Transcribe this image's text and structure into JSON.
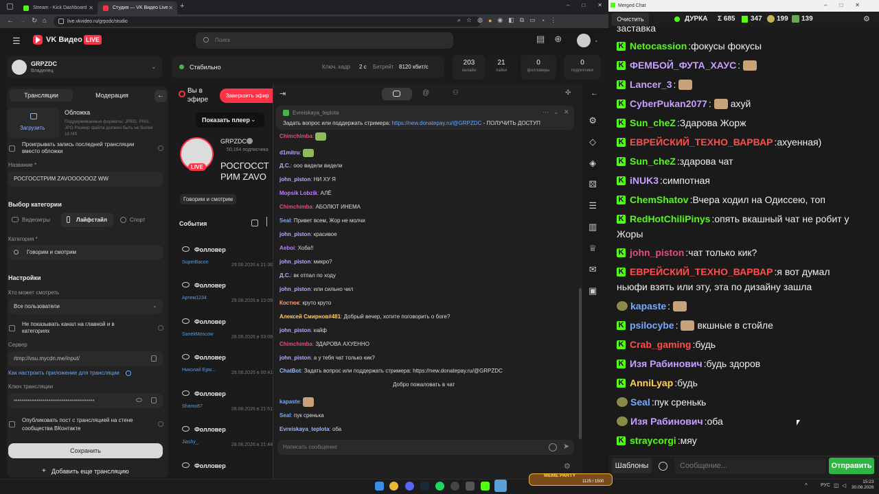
{
  "browser": {
    "tabs": [
      {
        "label": "Stream - Kick Dashboard",
        "favicon_color": "#53fc18"
      },
      {
        "label": "Студия — VK Видео Live",
        "favicon_color": "#ff3347"
      }
    ],
    "new_tab": "+",
    "url": "live.vkvideo.ru/grpzdc/studio",
    "win_controls": [
      "–",
      "□",
      "✕"
    ]
  },
  "vk": {
    "logo_text": "VK Видео",
    "live_badge": "LIVE",
    "search_placeholder": "Поиск",
    "channel": {
      "name": "GRPZDC",
      "role": "Владелец"
    },
    "status": "Стабильно",
    "keyframe_label": "Ключ. кадр",
    "keyframe_value": "2 с",
    "bitrate_label": "Битрейт",
    "bitrate_value": "8120 кбит/с",
    "stats": [
      {
        "value": "203",
        "label": "онлайн"
      },
      {
        "value": "21",
        "label": "лайки"
      },
      {
        "value": "0",
        "label": "фолловеры"
      },
      {
        "value": "0",
        "label": "подписчики"
      }
    ],
    "left_tabs": [
      "Трансляции",
      "Модерация"
    ],
    "cover": {
      "upload_label": "Загрузить",
      "title": "Обложка",
      "desc": "Поддерживаемые форматы: JPEG, PNG, JPG Размер файла должен быть не более 10 Мб"
    },
    "play_last": "Проигрывать запись последней трансляции вместо обложки",
    "name_label": "Название *",
    "name_value": "РОСГОССТРИМ ZAVOOOOOOZ WW",
    "category_section": "Выбор категории",
    "category_tabs": [
      "Видеоигры",
      "Лайфстайл",
      "Спорт"
    ],
    "category_label": "Категория *",
    "category_value": "Говорим и смотрим",
    "settings": "Настройки",
    "who_label": "Кто может смотреть",
    "who_value": "Все пользователи",
    "hide_label": "Не показывать канал на главной и в категориях",
    "server_label": "Сервер",
    "server_value": "rtmp://vsu.mycdn.me/input/",
    "howto": "Как настроить приложение для трансляции",
    "key_label": "Ключ трансляции",
    "key_value": "••••••••••••••••••••••••••••••••••••••••••",
    "publish_label": "Опубликовать пост с трансляцией на стене сообщества ВКонтакте",
    "save": "Сохранить",
    "add_stream": "Добавить еще трансляцию",
    "on_air": "Вы в эфире",
    "end_btn": "Завершить эфир",
    "show_player": "Показать плеер",
    "stream_channel": "GRPZDC",
    "stream_subs": "50,164 подписчика",
    "stream_title": "РОСГОССТРИМ ZAVOOOOOOZ WW",
    "stream_tag": "Говорим и смотрим",
    "events_title": "События",
    "events": [
      {
        "type": "Фолловер",
        "name": "SuperBacon",
        "date": "29.08.2026 в 21:36"
      },
      {
        "type": "Фолловер",
        "name": "Артем1234",
        "date": "29.08.2026 в 10:09"
      },
      {
        "type": "Фолловер",
        "name": "SanekMoscow",
        "date": "28.08.2026 в 03:09"
      },
      {
        "type": "Фолловер",
        "name": "Николай Ерм...",
        "date": "28.08.2026 в 00:41"
      },
      {
        "type": "Фолловер",
        "name": "Shamo87",
        "date": "28.08.2026 в 21:51"
      },
      {
        "type": "Фолловер",
        "name": "Jiashy_",
        "date": "28.08.2026 в 21:44"
      },
      {
        "type": "Фолловер",
        "name": "",
        "date": ""
      }
    ],
    "chat": {
      "pinned_user": "Evreiskaya_teplota",
      "pinned_text": "Задать вопрос или поддержать стримера: ",
      "pinned_link": "https://new.donatepay.ru/@GRPZDC",
      "pinned_tail": " - ПОЛУЧИТЬ ДОСТУП",
      "messages": [
        {
          "user": "Chimchimba",
          "text": "",
          "color": "#e0507a"
        },
        {
          "user": "d1mitru",
          "text": "",
          "color": "#b0b0ff"
        },
        {
          "user": "Д.С.",
          "text": "ооо видели видели",
          "color": "#c7a0ff"
        },
        {
          "user": "john_piston",
          "text": "НИ ХУ Я",
          "color": "#b0b0ff"
        },
        {
          "user": "Mopsik Lobzik",
          "text": "АЛЁ",
          "color": "#c07cff"
        },
        {
          "user": "Chimchimba",
          "text": "АБОЛЮТ ИНЕМА",
          "color": "#e0507a"
        },
        {
          "user": "Seal",
          "text": "Привет всем, Жор не молчи",
          "color": "#78a8ff"
        },
        {
          "user": "john_piston",
          "text": "красивое",
          "color": "#b0b0ff"
        },
        {
          "user": "Aeboi",
          "text": "Хоба!!",
          "color": "#c07cff"
        },
        {
          "user": "john_piston",
          "text": "микро?",
          "color": "#b0b0ff"
        },
        {
          "user": "Д.С.",
          "text": "вк отпал по ходу",
          "color": "#c7a0ff"
        },
        {
          "user": "john_piston",
          "text": "или сильно чил",
          "color": "#b0b0ff"
        },
        {
          "user": "Костюк",
          "text": "круто круто",
          "color": "#ff9f6b"
        },
        {
          "user": "Алексей Смирнов#481",
          "text": "Добрый вечер, хотите поговорить о боге?",
          "color": "#ffcc66"
        },
        {
          "user": "john_piston",
          "text": "кайф",
          "color": "#b0b0ff"
        },
        {
          "user": "Chimchimba",
          "text": "ЗДАРОВА АХУЕННО",
          "color": "#e0507a"
        },
        {
          "user": "john_piston",
          "text": "а у тебя чат только кик?",
          "color": "#b0b0ff"
        },
        {
          "user": "ChatBot",
          "text": "Задать вопрос или поддержать стримера: https://new.donatepay.ru/@GRPZDC",
          "color": "#9ab8ff"
        }
      ],
      "welcome": "Добро пожаловать в чат",
      "after": [
        {
          "user": "kapaste",
          "text": "",
          "color": "#78a8ff"
        },
        {
          "user": "Seal",
          "text": "пук сренька",
          "color": "#78a8ff"
        },
        {
          "user": "Evreiskaya_teplota",
          "text": "оба",
          "color": "#9ab8ff"
        }
      ],
      "input_placeholder": "Написать сообщение"
    }
  },
  "merged": {
    "window_title": "Merged Chat",
    "clear": "Очистить",
    "stream_name": "ДУРКА",
    "total": "Σ 685",
    "kick_count": "347",
    "vk_count": "199",
    "other_count": "139",
    "top_cut": "заставка",
    "messages": [
      {
        "src": "kick",
        "user": "Netocassion",
        "text": "фокусы фокусы",
        "color": "#53fc18"
      },
      {
        "src": "kick",
        "user": "ФЕМБОЙ_ФУТА_ХАУС",
        "text": "",
        "color": "#c7a0ff",
        "emote": true
      },
      {
        "src": "kick",
        "user": "Lancer_3",
        "text": "",
        "color": "#c7a0ff",
        "emote": true
      },
      {
        "src": "kick",
        "user": "CyberPukan2077",
        "text": "ахуй",
        "color": "#c7a0ff",
        "emote": true
      },
      {
        "src": "kick",
        "user": "Sun_cheZ",
        "text": "Здарова Жорж",
        "color": "#53fc18"
      },
      {
        "src": "kick",
        "user": "ЕВРЕЙСКИЙ_ТЕХНО_ВАРВАР",
        "text": "ахуенная)",
        "color": "#ff4d4d"
      },
      {
        "src": "kick",
        "user": "Sun_cheZ",
        "text": "здарова чат",
        "color": "#53fc18"
      },
      {
        "src": "kick",
        "user": "iNUK3",
        "text": "симпотная",
        "color": "#c7a0ff"
      },
      {
        "src": "kick",
        "user": "ChemShatov",
        "text": "Вчера ходил на Одиссею, топ",
        "color": "#53fc18"
      },
      {
        "src": "kick",
        "user": "RedHotChiliPinys",
        "text": "опять вкашный чат не робит у",
        "color": "#53fc18",
        "cont": "Жоры"
      },
      {
        "src": "kick",
        "user": "john_piston",
        "text": "чат только кик?",
        "color": "#e0507a"
      },
      {
        "src": "kick",
        "user": "ЕВРЕЙСКИЙ_ТЕХНО_ВАРВАР",
        "text": "я вот думал",
        "color": "#ff4d4d",
        "cont": "ньюфи взять или эту, эта по дизайну зашла"
      },
      {
        "src": "vk",
        "user": "kapaste",
        "text": "",
        "color": "#78a8ff",
        "emote": true
      },
      {
        "src": "kick",
        "user": "psilocybe",
        "text": "вкшные в стойле",
        "color": "#78a8ff",
        "emote": true
      },
      {
        "src": "kick",
        "user": "Crab_gaming",
        "text": "будь",
        "color": "#ff4d4d"
      },
      {
        "src": "kick",
        "user": "Изя Рабинович",
        "text": "будь здоров",
        "color": "#c7a0ff"
      },
      {
        "src": "kick",
        "user": "AnniLyap",
        "text": "будь",
        "color": "#ffd24d"
      },
      {
        "src": "vk",
        "user": "Seal",
        "text": "пук сренькь",
        "color": "#78a8ff"
      },
      {
        "src": "vk",
        "user": "Изя Рабинович",
        "text": "оба",
        "color": "#c7a0ff"
      },
      {
        "src": "kick",
        "user": "straycorgi",
        "text": "мяу",
        "color": "#53fc18"
      }
    ],
    "templates": "Шаблоны",
    "input_placeholder": "Сообщение...",
    "send": "Отправить"
  },
  "taskbar": {
    "lang": "РУС",
    "time": "15:23",
    "date": "30.08.2026",
    "game_banner": "MEME PARTY",
    "game_progress": "1125 / 1500"
  }
}
